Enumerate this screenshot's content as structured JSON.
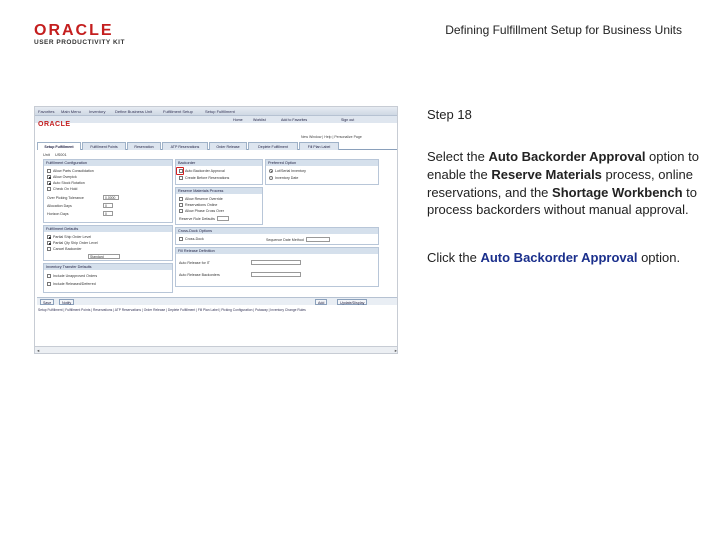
{
  "branding": {
    "logo_word": "ORACLE",
    "logo_sub": "USER PRODUCTIVITY KIT"
  },
  "page_title": "Defining Fulfillment Setup for Business Units",
  "screenshot": {
    "breadcrumbs": [
      "Favorites",
      "Main Menu",
      "Inventory",
      "Define Business Unit",
      "Fulfillment Setup",
      "Setup Fulfillment"
    ],
    "nav_links": [
      "Home",
      "Worklist",
      "Add to Favorites",
      "Sign out"
    ],
    "mini_logo": "ORACLE",
    "toolbar_right": "New Window | Help | Personalize Page",
    "tabs": [
      "Setup Fulfillment",
      "Fulfillment Points",
      "Reservation",
      "ATP Reservations",
      "Order Release",
      "Deplete Fulfillment",
      "Fill Plan Label"
    ],
    "unit_label": "Unit",
    "unit_value": "US001",
    "groups": {
      "fulfillment_config": "Fulfillment Configuration",
      "backorder": "Backorder",
      "preferred_option": "Preferred Option",
      "reservation_process": "Reserve Materials Process",
      "cross_dock": "Cross-Dock Options",
      "auto_codes": "Fulfillment Defaults",
      "rule_defaults": "Inventory Transfer Defaults",
      "release_list": "Fill Release Definition"
    },
    "config_items": [
      "Allow Parts Consolidation",
      "Allow Overpick",
      "Auto Stock Rotation",
      "Check On Hold"
    ],
    "config_fields": [
      {
        "label": "Over Picking Tolerance",
        "value": "0.0000"
      },
      {
        "label": "Allocation Days",
        "value": "0"
      },
      {
        "label": "Horizon Days",
        "value": "0"
      }
    ],
    "backorder_items": [
      "Auto Backorder Approval",
      "Create Before Reservations"
    ],
    "preferred_items": [
      "Lot/Serial Inventory",
      "Inventory Date"
    ],
    "reservation_items": [
      "Allow Reserve Override",
      "Reservations Online",
      "Allow Phase Cross Over",
      "Reserve Rule Defaults"
    ],
    "cross_dock_items": [
      "Cross-Dock",
      "Sequence Date Method"
    ],
    "fulfillment_defaults": [
      "Partial Ship Order Level",
      "Partial Qty Ship Order Level",
      "Cancel Backorder"
    ],
    "fulfillment_select_value": "Standard",
    "transfer_defaults": [
      "Include Unapproved Orders",
      "Include Released/Deferred"
    ],
    "release_fields": [
      "Auto Release for IT",
      "Auto Release Backorders"
    ],
    "buttons": {
      "save": "Save",
      "notify": "Notify",
      "add": "Add",
      "update": "Update/Display"
    },
    "footer_links": "Setup Fulfillment | Fulfillment Points | Reservations | ATP Reservations | Order Release | Deplete Fulfillment | Fill Plan Label | Picking Configuration | Putaway | Inventory Change Rules"
  },
  "instructions": {
    "step": "Step 18",
    "desc_before": "Select the ",
    "desc_bold1": "Auto Backorder Approval",
    "desc_mid1": " option to enable the ",
    "desc_bold2": "Reserve Materials",
    "desc_mid2": " process, online reservations, and the ",
    "desc_bold3": "Shortage Workbench",
    "desc_after": " to process backorders without manual approval.",
    "click_before": "Click the ",
    "click_link": "Auto Backorder Approval",
    "click_after": " option."
  }
}
